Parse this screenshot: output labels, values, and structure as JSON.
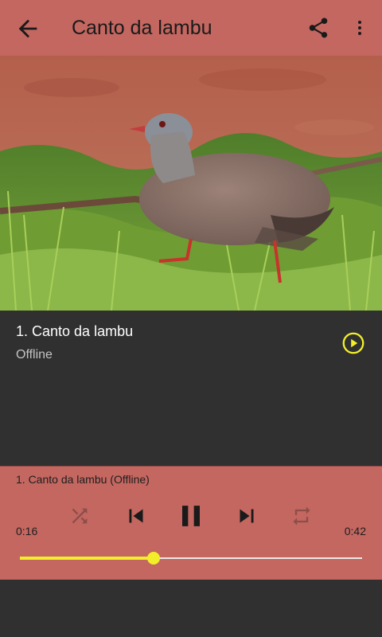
{
  "appbar": {
    "title": "Canto da lambu",
    "back_icon": "arrow-back-icon",
    "share_icon": "share-icon",
    "more_icon": "more-vert-icon"
  },
  "photo": {
    "subject": "bird-photo"
  },
  "track": {
    "name": "1. Canto da lambu",
    "status": "Offline",
    "play_icon": "play-circle-icon"
  },
  "player": {
    "now_playing": "1. Canto da lambu (Offline)",
    "current_time": "0:16",
    "total_time": "0:42",
    "progress": 0.39,
    "controls": [
      "shuffle-icon",
      "skip-previous-icon",
      "pause-icon",
      "skip-next-icon",
      "repeat-icon"
    ]
  },
  "colors": {
    "accent": "#c36760",
    "background": "#303030",
    "progress": "#f2ef2a"
  }
}
